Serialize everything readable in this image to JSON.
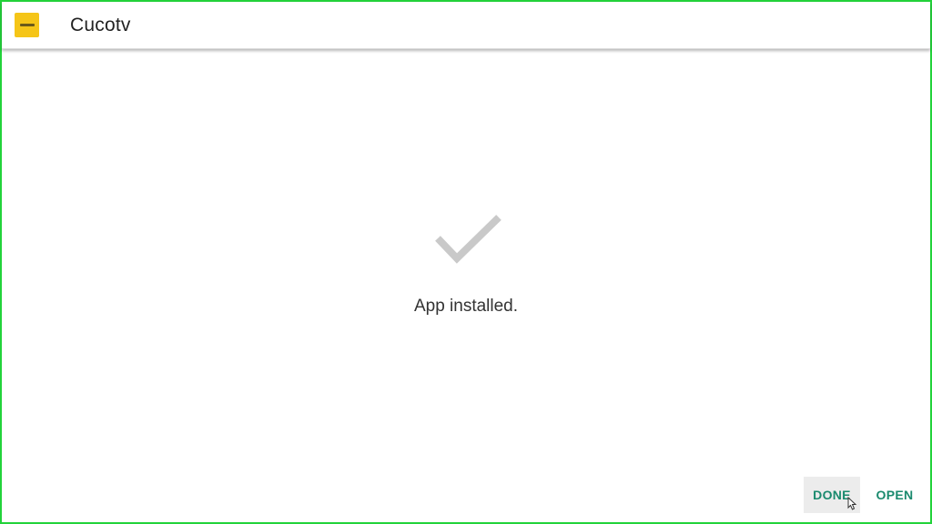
{
  "colors": {
    "frame_border": "#22d33a",
    "accent": "#1a8a6e",
    "app_icon_bg": "#f5c518",
    "check_mark": "#c9c9c9"
  },
  "header": {
    "title": "Cucotv",
    "app_icon": "cucotv-app-icon"
  },
  "main": {
    "status_icon": "check-icon",
    "status_text": "App installed."
  },
  "actions": {
    "done_label": "DONE",
    "open_label": "OPEN"
  }
}
